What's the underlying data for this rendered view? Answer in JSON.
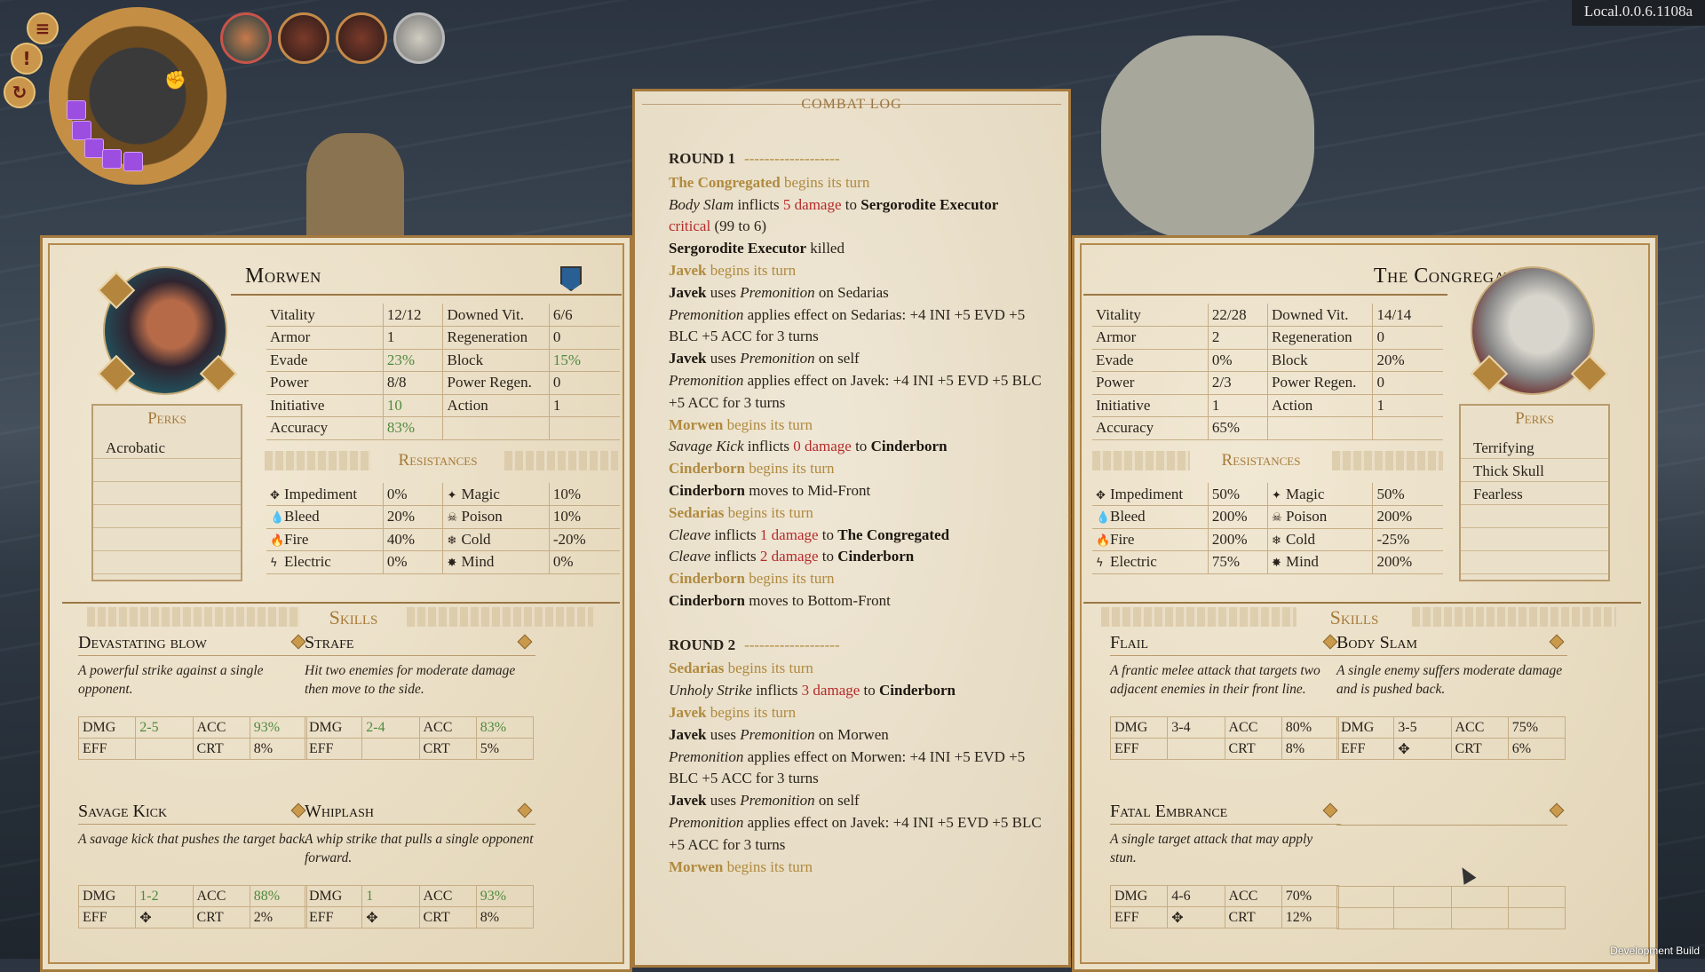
{
  "version": "Local.0.0.6.1108a",
  "dev_build": "Development Build",
  "hud": {
    "buttons": [
      "≡",
      "!",
      "↻"
    ]
  },
  "combat_log": {
    "title": "COMBAT LOG",
    "lines": [
      {
        "round": "ROUND 1",
        "dash": "-------------------"
      },
      [
        {
          "t": "The Congregated",
          "s": "gb"
        },
        {
          "t": " begins its turn",
          "s": "g"
        }
      ],
      [
        {
          "t": "Body Slam",
          "s": "i"
        },
        {
          "t": "  inflicts ",
          "s": "n"
        },
        {
          "t": "5 damage",
          "s": "r"
        },
        {
          "t": " to ",
          "s": "n"
        },
        {
          "t": "Sergorodite Executor",
          "s": "b"
        }
      ],
      [
        {
          "t": "critical",
          "s": "r"
        },
        {
          "t": " (99 to 6)",
          "s": "n"
        }
      ],
      [
        {
          "t": "Sergorodite Executor",
          "s": "b"
        },
        {
          "t": " killed",
          "s": "n"
        }
      ],
      [
        {
          "t": "Javek",
          "s": "gb"
        },
        {
          "t": " begins its turn",
          "s": "g"
        }
      ],
      [
        {
          "t": "Javek",
          "s": "b"
        },
        {
          "t": " uses ",
          "s": "n"
        },
        {
          "t": "Premonition",
          "s": "i"
        },
        {
          "t": "  on Sedarias",
          "s": "n"
        }
      ],
      [
        {
          "t": "Premonition",
          "s": "i"
        },
        {
          "t": "  applies effect on Sedarias: +4 INI +5 EVD +5 BLC +5 ACC  for 3 turns",
          "s": "n"
        }
      ],
      [
        {
          "t": "Javek",
          "s": "b"
        },
        {
          "t": " uses ",
          "s": "n"
        },
        {
          "t": "Premonition",
          "s": "i"
        },
        {
          "t": "  on self",
          "s": "n"
        }
      ],
      [
        {
          "t": "Premonition",
          "s": "i"
        },
        {
          "t": "  applies effect on Javek: +4 INI +5 EVD +5 BLC +5 ACC  for 3 turns",
          "s": "n"
        }
      ],
      [
        {
          "t": "Morwen",
          "s": "gb"
        },
        {
          "t": " begins its turn",
          "s": "g"
        }
      ],
      [
        {
          "t": "Savage Kick",
          "s": "i"
        },
        {
          "t": "  inflicts ",
          "s": "n"
        },
        {
          "t": "0 damage",
          "s": "r"
        },
        {
          "t": " to ",
          "s": "n"
        },
        {
          "t": "Cinderborn",
          "s": "b"
        }
      ],
      [
        {
          "t": "Cinderborn",
          "s": "gb"
        },
        {
          "t": " begins its turn",
          "s": "g"
        }
      ],
      [
        {
          "t": "Cinderborn",
          "s": "b"
        },
        {
          "t": " moves to Mid-Front",
          "s": "n"
        }
      ],
      [
        {
          "t": "Sedarias",
          "s": "gb"
        },
        {
          "t": " begins its turn",
          "s": "g"
        }
      ],
      [
        {
          "t": "Cleave",
          "s": "i"
        },
        {
          "t": "  inflicts ",
          "s": "n"
        },
        {
          "t": "1 damage",
          "s": "r"
        },
        {
          "t": " to ",
          "s": "n"
        },
        {
          "t": "The Congregated",
          "s": "b"
        }
      ],
      [
        {
          "t": "Cleave",
          "s": "i"
        },
        {
          "t": "  inflicts ",
          "s": "n"
        },
        {
          "t": "2 damage",
          "s": "r"
        },
        {
          "t": " to ",
          "s": "n"
        },
        {
          "t": "Cinderborn",
          "s": "b"
        }
      ],
      [
        {
          "t": "Cinderborn",
          "s": "gb"
        },
        {
          "t": " begins its turn",
          "s": "g"
        }
      ],
      [
        {
          "t": "Cinderborn",
          "s": "b"
        },
        {
          "t": " moves to Bottom-Front",
          "s": "n"
        }
      ],
      {
        "blank": true
      },
      {
        "round": "ROUND 2",
        "dash": "-------------------"
      },
      [
        {
          "t": "Sedarias",
          "s": "gb"
        },
        {
          "t": " begins its turn",
          "s": "g"
        }
      ],
      [
        {
          "t": "Unholy Strike",
          "s": "i"
        },
        {
          "t": "  inflicts ",
          "s": "n"
        },
        {
          "t": "3 damage",
          "s": "r"
        },
        {
          "t": " to ",
          "s": "n"
        },
        {
          "t": "Cinderborn",
          "s": "b"
        }
      ],
      [
        {
          "t": "Javek",
          "s": "gb"
        },
        {
          "t": " begins its turn",
          "s": "g"
        }
      ],
      [
        {
          "t": "Javek",
          "s": "b"
        },
        {
          "t": " uses ",
          "s": "n"
        },
        {
          "t": "Premonition",
          "s": "i"
        },
        {
          "t": "  on Morwen",
          "s": "n"
        }
      ],
      [
        {
          "t": "Premonition",
          "s": "i"
        },
        {
          "t": "  applies effect on Morwen: +4 INI +5 EVD +5 BLC +5 ACC  for 3 turns",
          "s": "n"
        }
      ],
      [
        {
          "t": "Javek",
          "s": "b"
        },
        {
          "t": " uses ",
          "s": "n"
        },
        {
          "t": "Premonition",
          "s": "i"
        },
        {
          "t": "  on self",
          "s": "n"
        }
      ],
      [
        {
          "t": "Premonition",
          "s": "i"
        },
        {
          "t": "  applies effect on Javek: +4 INI +5 EVD +5 BLC +5 ACC  for 3 turns",
          "s": "n"
        }
      ],
      [
        {
          "t": "Morwen",
          "s": "gb"
        },
        {
          "t": " begins its turn",
          "s": "g"
        }
      ]
    ]
  },
  "left": {
    "name": "Morwen",
    "perks_title": "Perks",
    "perks": [
      "Acrobatic"
    ],
    "stats": [
      [
        "Vitality",
        "12/12",
        "Downed Vit.",
        "6/6"
      ],
      [
        "Armor",
        "1",
        "Regeneration",
        "0"
      ],
      [
        "Evade",
        "23%",
        "Block",
        "15%"
      ],
      [
        "Power",
        "8/8",
        "Power Regen.",
        "0"
      ],
      [
        "Initiative",
        "10",
        "Action",
        "1"
      ],
      [
        "Accuracy",
        "83%",
        "",
        ""
      ]
    ],
    "green_cells": [
      "23%",
      "15%",
      "10",
      "83%"
    ],
    "resist_title": "Resistances",
    "resists": [
      [
        "Impediment",
        "0%",
        "Magic",
        "10%"
      ],
      [
        "Bleed",
        "20%",
        "Poison",
        "10%"
      ],
      [
        "Fire",
        "40%",
        "Cold",
        "-20%"
      ],
      [
        "Electric",
        "0%",
        "Mind",
        "0%"
      ]
    ],
    "skills_title": "Skills",
    "skills": [
      {
        "name": "Devastating blow",
        "desc": "A powerful strike against a single opponent.",
        "dmg": "2-5",
        "acc": "93%",
        "eff": "",
        "crt": "8%",
        "green": true
      },
      {
        "name": "Strafe",
        "desc": "Hit two enemies for moderate damage then move to the side.",
        "dmg": "2-4",
        "acc": "83%",
        "eff": "",
        "crt": "5%",
        "green": true
      },
      {
        "name": "Savage Kick",
        "desc": "A savage kick that pushes the target back.",
        "dmg": "1-2",
        "acc": "88%",
        "eff": "✥",
        "crt": "2%",
        "green": true
      },
      {
        "name": "Whiplash",
        "desc": "A whip strike that pulls a single opponent forward.",
        "dmg": "1",
        "acc": "93%",
        "eff": "✥",
        "crt": "8%",
        "green": true
      }
    ]
  },
  "right": {
    "name": "The Congregated",
    "perks_title": "Perks",
    "perks": [
      "Terrifying",
      "Thick Skull",
      "Fearless"
    ],
    "stats": [
      [
        "Vitality",
        "22/28",
        "Downed Vit.",
        "14/14"
      ],
      [
        "Armor",
        "2",
        "Regeneration",
        "0"
      ],
      [
        "Evade",
        "0%",
        "Block",
        "20%"
      ],
      [
        "Power",
        "2/3",
        "Power Regen.",
        "0"
      ],
      [
        "Initiative",
        "1",
        "Action",
        "1"
      ],
      [
        "Accuracy",
        "65%",
        "",
        ""
      ]
    ],
    "resist_title": "Resistances",
    "resists": [
      [
        "Impediment",
        "50%",
        "Magic",
        "50%"
      ],
      [
        "Bleed",
        "200%",
        "Poison",
        "200%"
      ],
      [
        "Fire",
        "200%",
        "Cold",
        "-25%"
      ],
      [
        "Electric",
        "75%",
        "Mind",
        "200%"
      ]
    ],
    "skills_title": "Skills",
    "skills": [
      {
        "name": "Flail",
        "desc": "A frantic melee attack that targets two adjacent enemies in their front line.",
        "dmg": "3-4",
        "acc": "80%",
        "eff": "",
        "crt": "8%"
      },
      {
        "name": "Body Slam",
        "desc": "A single enemy suffers moderate damage and is pushed back.",
        "dmg": "3-5",
        "acc": "75%",
        "eff": "✥",
        "crt": "6%"
      },
      {
        "name": "Fatal Embrance",
        "desc": "A single target attack that may apply stun.",
        "dmg": "4-6",
        "acc": "70%",
        "eff": "✥",
        "crt": "12%"
      },
      {
        "name": "",
        "desc": "",
        "dmg": "",
        "acc": "",
        "eff": "",
        "crt": "",
        "empty": true
      }
    ]
  },
  "labels": {
    "dmg": "DMG",
    "acc": "ACC",
    "eff": "EFF",
    "crt": "CRT"
  },
  "resist_icons": {
    "Impediment": "✥",
    "Magic": "✦",
    "Bleed": "💧",
    "Poison": "☠",
    "Fire": "🔥",
    "Cold": "❄",
    "Electric": "ϟ",
    "Mind": "✸"
  },
  "colors": {
    "gold": "#b08a3e",
    "damage_red": "#b52a2a",
    "buff_green": "#4f8a3e",
    "action_purple": "#9b4ee0"
  }
}
